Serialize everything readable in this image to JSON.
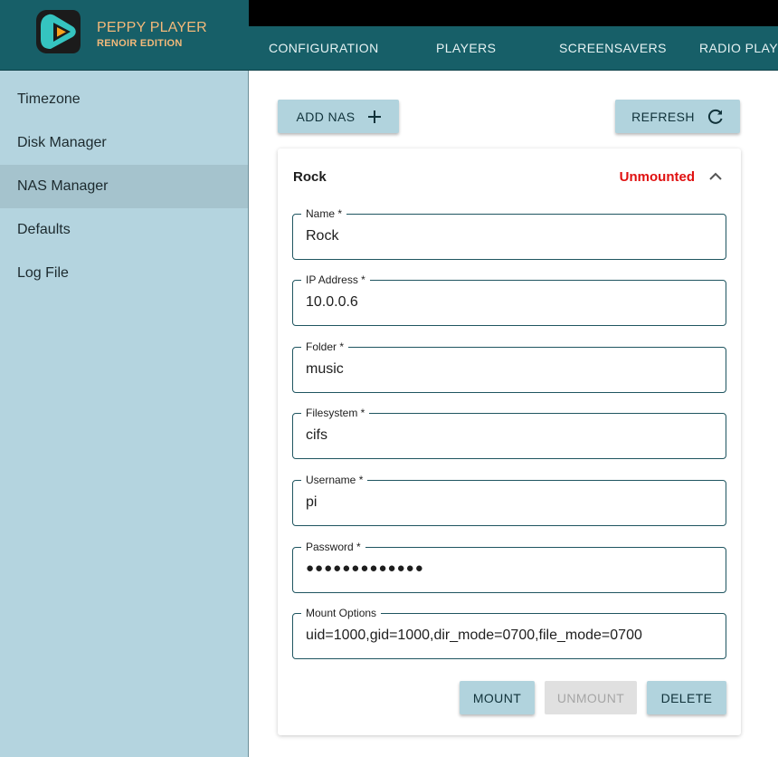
{
  "brand": {
    "title": "PEPPY PLAYER",
    "subtitle": "RENOIR EDITION"
  },
  "tabs": [
    "CONFIGURATION",
    "PLAYERS",
    "SCREENSAVERS",
    "RADIO PLAYER"
  ],
  "sidebar": {
    "items": [
      {
        "label": "Timezone",
        "active": false
      },
      {
        "label": "Disk Manager",
        "active": false
      },
      {
        "label": "NAS Manager",
        "active": true
      },
      {
        "label": "Defaults",
        "active": false
      },
      {
        "label": "Log File",
        "active": false
      }
    ]
  },
  "toolbar": {
    "add_label": "ADD NAS",
    "refresh_label": "REFRESH"
  },
  "nas": {
    "title": "Rock",
    "status": "Unmounted",
    "fields": [
      {
        "label": "Name *",
        "value": "Rock"
      },
      {
        "label": "IP Address *",
        "value": "10.0.0.6"
      },
      {
        "label": "Folder *",
        "value": "music"
      },
      {
        "label": "Filesystem *",
        "value": "cifs"
      },
      {
        "label": "Username *",
        "value": "pi"
      },
      {
        "label": "Password *",
        "value": "●●●●●●●●●●●●●"
      },
      {
        "label": "Mount Options",
        "value": "uid=1000,gid=1000,dir_mode=0700,file_mode=0700"
      }
    ],
    "actions": {
      "mount": "MOUNT",
      "unmount": "UNMOUNT",
      "delete": "DELETE"
    }
  },
  "colors": {
    "header": "#175f68",
    "sidebar": "#b4d4df",
    "sidebar_active": "#a5c3cd",
    "button": "#b1d3dd",
    "status_unmounted": "#e01010",
    "brand_text": "#f3b97a"
  },
  "icons": {
    "logo": "play-logo-icon",
    "add": "plus-icon",
    "refresh": "refresh-icon",
    "collapse": "chevron-up-icon"
  }
}
